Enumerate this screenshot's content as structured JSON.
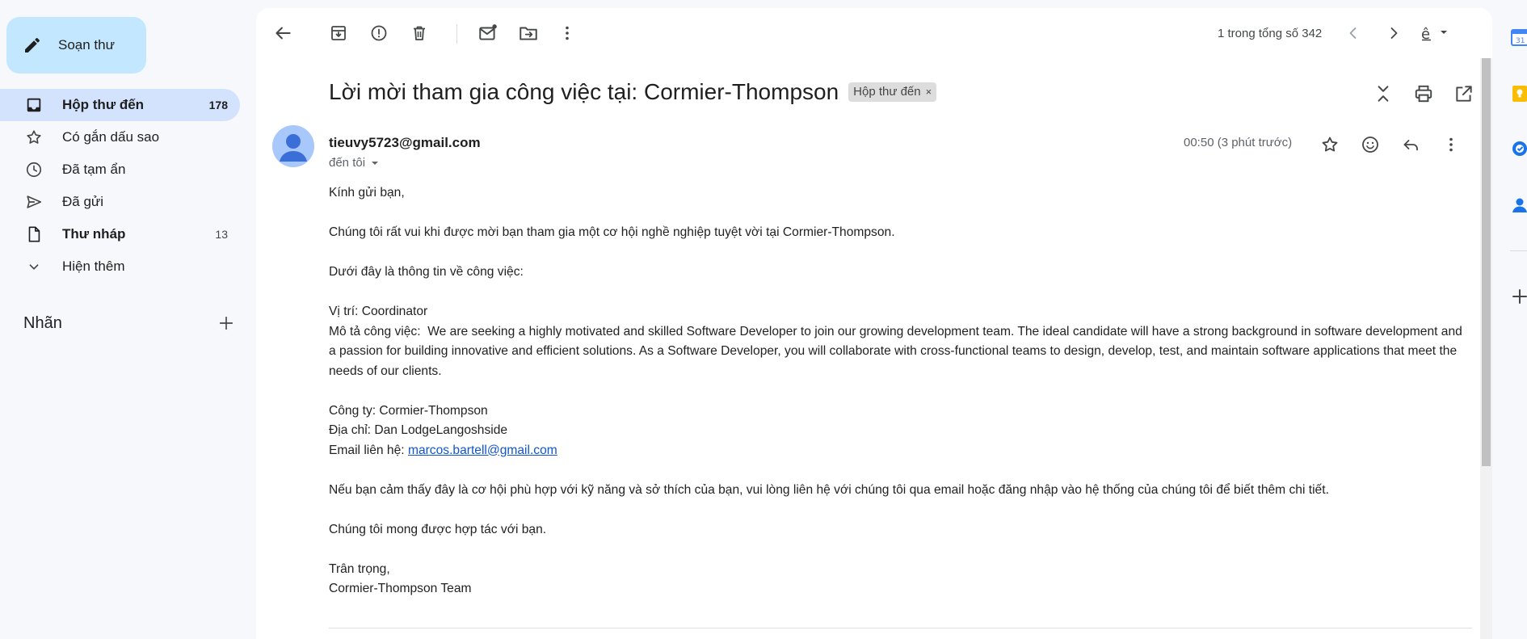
{
  "compose": {
    "label": "Soạn thư"
  },
  "nav": {
    "items": [
      {
        "label": "Hộp thư đến",
        "count": "178",
        "icon": "inbox-icon"
      },
      {
        "label": "Có gắn dấu sao",
        "count": "",
        "icon": "star-icon"
      },
      {
        "label": "Đã tạm ẩn",
        "count": "",
        "icon": "clock-icon"
      },
      {
        "label": "Đã gửi",
        "count": "",
        "icon": "send-icon"
      },
      {
        "label": "Thư nháp",
        "count": "13",
        "icon": "draft-icon"
      },
      {
        "label": "Hiện thêm",
        "count": "",
        "icon": "chevron-down-icon"
      }
    ]
  },
  "labels": {
    "title": "Nhãn"
  },
  "toolbar": {
    "pager": "1 trong tổng số 342"
  },
  "email": {
    "subject": "Lời mời tham gia công việc tại: Cormier-Thompson",
    "label_chip": "Hộp thư đến",
    "label_chip_close": "×",
    "sender": "tieuvy5723@gmail.com",
    "to": "đến tôi",
    "time": "00:50 (3 phút trước)",
    "body": {
      "greeting": "Kính gửi bạn,",
      "intro": "Chúng tôi rất vui khi được mời bạn tham gia một cơ hội nghề nghiệp tuyệt vời tại Cormier-Thompson.",
      "info_header": "Dưới đây là thông tin về công việc:",
      "position": "Vị trí: Coordinator",
      "description": "Mô tả công việc:  We are seeking a highly motivated and skilled Software Developer to join our growing development team. The ideal candidate will have a strong background in software development and a passion for building innovative and efficient solutions. As a Software Developer, you will collaborate with cross-functional teams to design, develop, test, and maintain software applications that meet the needs of our clients.",
      "company": "Công ty: Cormier-Thompson",
      "address": "Địa chỉ: Dan LodgeLangoshside",
      "contact_label": "Email liên hệ: ",
      "contact_email": "marcos.bartell@gmail.com",
      "cta": "Nếu bạn cảm thấy đây là cơ hội phù hợp với kỹ năng và sở thích của bạn, vui lòng liên hệ với chúng tôi qua email hoặc đăng nhập vào hệ thống của chúng tôi để biết thêm chi tiết.",
      "closing": "Chúng tôi mong được hợp tác với bạn.",
      "regards": "Trân trọng,",
      "signature": "Cormier-Thompson Team"
    }
  },
  "colors": {
    "background": "#f6f8fc",
    "compose_bg": "#c2e7ff",
    "nav_active_bg": "#d3e3fd",
    "link": "#1155cc",
    "avatar_bg": "#a8c7fa"
  }
}
